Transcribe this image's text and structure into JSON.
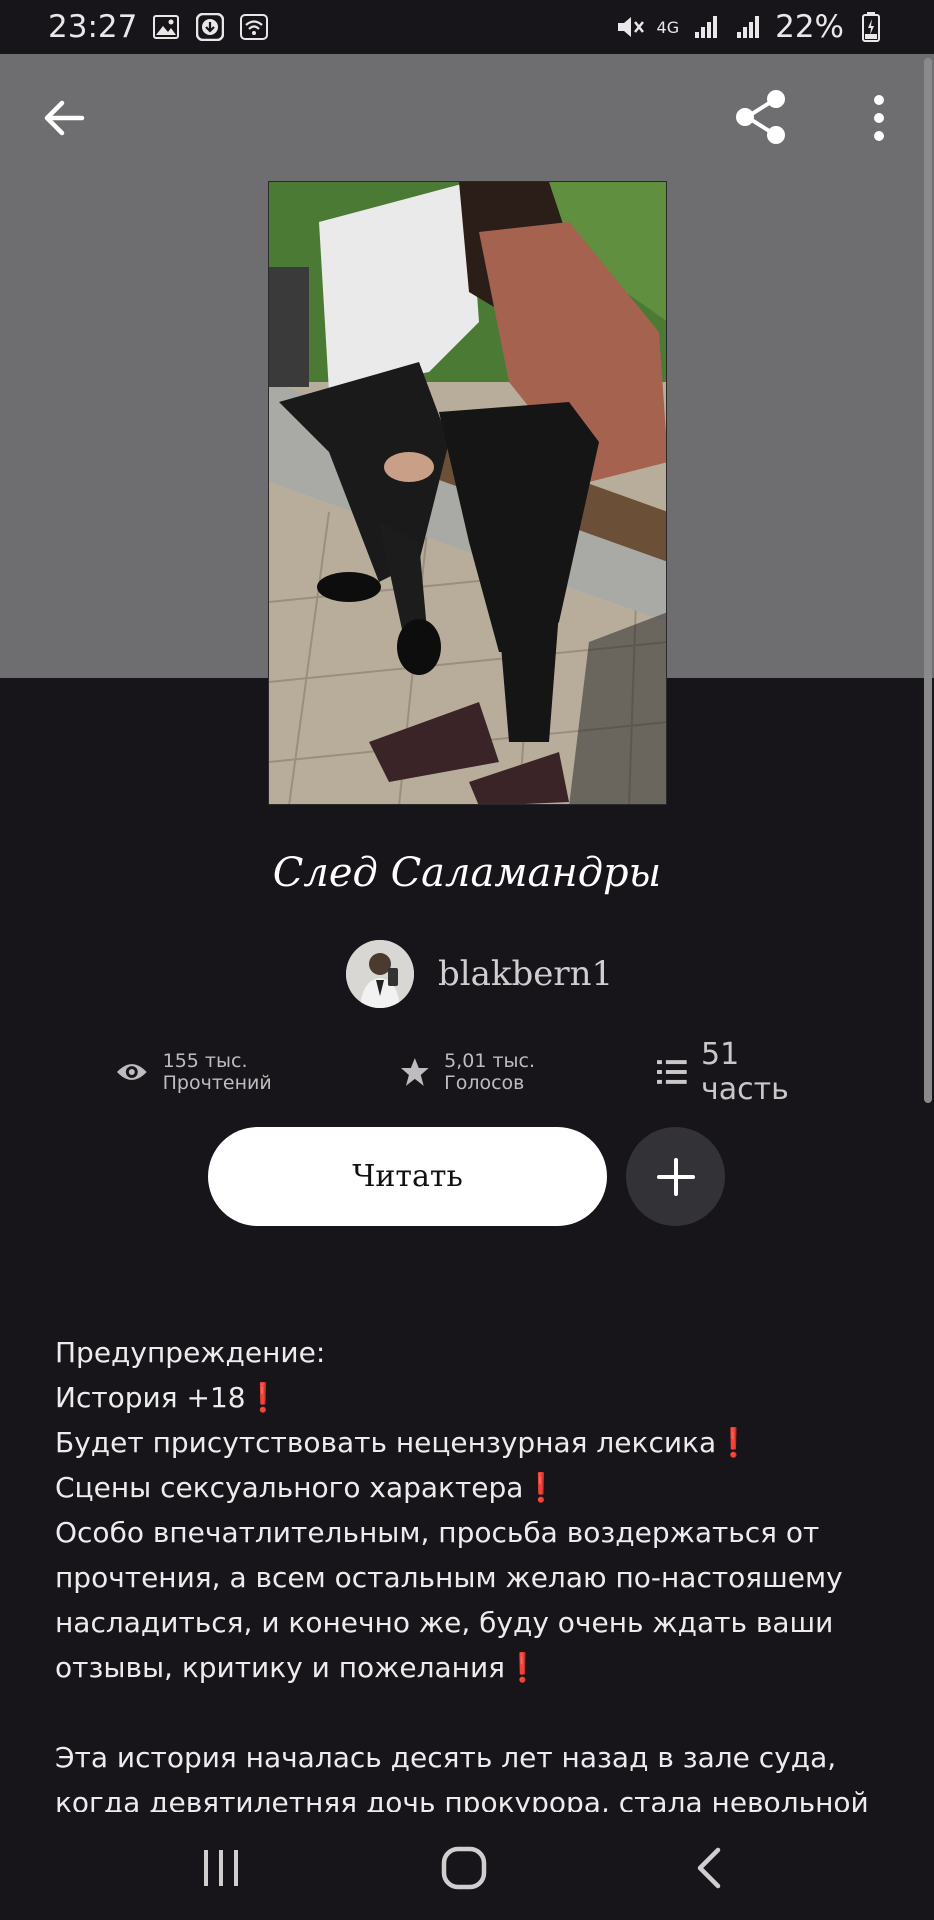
{
  "status_bar": {
    "time": "23:27",
    "network": "4G",
    "battery": "22%",
    "icons": [
      "image-icon",
      "download-icon",
      "wifi-icon",
      "mute-icon",
      "signal-icon",
      "signal-icon",
      "battery-charging-icon"
    ]
  },
  "header": {
    "back_icon": "arrow-left-icon",
    "share_icon": "share-icon",
    "more_icon": "more-vertical-icon"
  },
  "story": {
    "title": "След Саламандры",
    "author": "blakbern1",
    "reads": "155 тыс. Прочтений",
    "votes": "5,01 тыс. Голосов",
    "parts": "51 часть"
  },
  "actions": {
    "read_label": "Читать",
    "add_icon": "plus-icon"
  },
  "description": {
    "lines": [
      "Предупреждение:",
      "История +18",
      "Будет присутствовать нецензурная лексика",
      "Сцены сексуального характера",
      "Особо впечатлительным, просьба воздержаться от",
      "прочтения, а всем остальным желаю по-настояшему",
      "насладиться, и конечно же, буду очень ждать ваши",
      "отзывы, критику и пожелания",
      "Эта история началась десять лет назад в зале суда,",
      "когда девятилетняя дочь прокурора, стала невольной"
    ],
    "warn_mark": "❗"
  },
  "colors": {
    "background": "#17151a",
    "header_bg": "#6e6e70",
    "button_bg": "#ffffff",
    "add_button_bg": "#333237",
    "warning": "#e01b1b"
  },
  "nav_bar": {
    "icons": [
      "recent-apps-icon",
      "home-icon",
      "back-icon"
    ]
  }
}
